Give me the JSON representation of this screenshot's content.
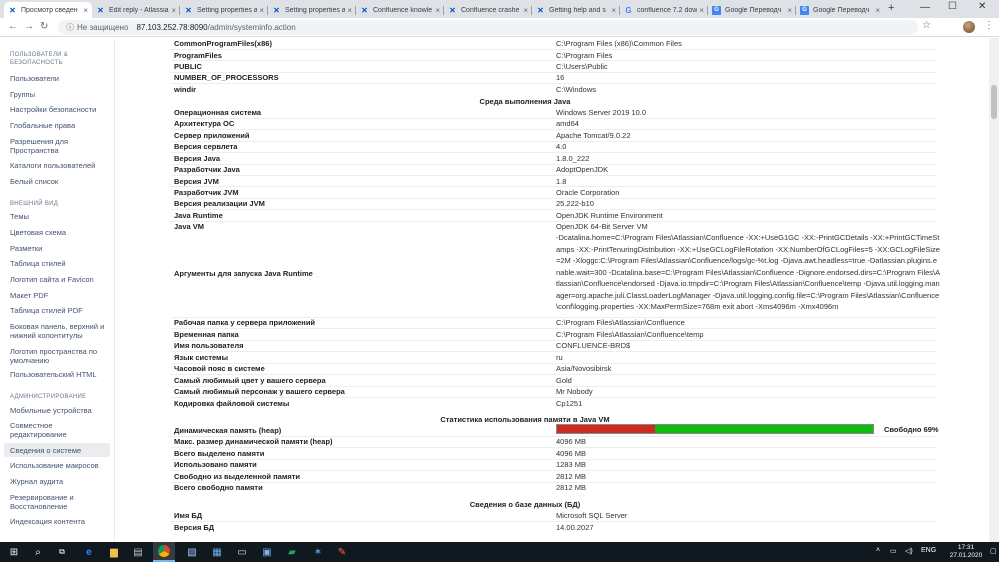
{
  "browser": {
    "tabs": [
      {
        "title": "Просмотр сведен",
        "icon": "confluence-icon",
        "active": true
      },
      {
        "title": "Edit reply - Atlassia",
        "icon": "confluence-icon"
      },
      {
        "title": "Setting properties a",
        "icon": "confluence-icon"
      },
      {
        "title": "Setting properties a",
        "icon": "confluence-icon"
      },
      {
        "title": "Confluence knowle",
        "icon": "confluence-icon"
      },
      {
        "title": "Confluence crashe",
        "icon": "confluence-icon"
      },
      {
        "title": "Getting help and s",
        "icon": "confluence-icon"
      },
      {
        "title": "confluence 7.2 dow",
        "icon": "google-icon"
      },
      {
        "title": "Google Переводч",
        "icon": "translate-icon"
      },
      {
        "title": "Google Переводч",
        "icon": "translate-icon"
      }
    ],
    "security_label": "Не защищено",
    "url_host": "87.103.252.78:8090",
    "url_path": "/admin/systeminfo.action"
  },
  "sidebar": {
    "sections": [
      {
        "heading": "ПОЛЬЗОВАТЕЛИ & БЕЗОПАСНОСТЬ",
        "items": [
          "Пользователи",
          "Группы",
          "Настройки безопасности",
          "Глобальные права",
          "Разрешения для Пространства",
          "Каталоги пользователей",
          "Белый список"
        ]
      },
      {
        "heading": "ВНЕШНИЙ ВИД",
        "items": [
          "Темы",
          "Цветовая схема",
          "Разметки",
          "Таблица стилей",
          "Логотип сайта и Favicon",
          "Макет PDF",
          "Таблица стилей PDF",
          "Боковая панель, верхний и нижний колонтитулы",
          "Логотип пространства по умолчанию",
          "Пользовательский HTML"
        ]
      },
      {
        "heading": "АДМИНИСТРИРОВАНИЕ",
        "items": [
          "Мобильные устройства",
          "Совместное редактирование",
          "Сведения о системе",
          "Использование макросов",
          "Журнал аудита",
          "Резервирование и Восстановление",
          "Индексация контента"
        ]
      }
    ],
    "active_item": "Сведения о системе"
  },
  "env_rows_top": [
    {
      "key": "CommonProgramFiles(x86)",
      "value": "C:\\Program Files (x86)\\Common Files"
    },
    {
      "key": "ProgramFiles",
      "value": "C:\\Program Files"
    },
    {
      "key": "PUBLIC",
      "value": "C:\\Users\\Public"
    },
    {
      "key": "NUMBER_OF_PROCESSORS",
      "value": "16"
    },
    {
      "key": "windir",
      "value": "C:\\Windows"
    }
  ],
  "java_section": {
    "title": "Среда выполнения Java",
    "rows": [
      {
        "key": "Операционная система",
        "value": "Windows Server 2019 10.0"
      },
      {
        "key": "Архитектура ОС",
        "value": "amd64"
      },
      {
        "key": "Сервер приложений",
        "value": "Apache Tomcat/9.0.22"
      },
      {
        "key": "Версия сервлета",
        "value": "4.0"
      },
      {
        "key": "Версия Java",
        "value": "1.8.0_222"
      },
      {
        "key": "Разработчик Java",
        "value": "AdoptOpenJDK"
      },
      {
        "key": "Версия JVM",
        "value": "1.8"
      },
      {
        "key": "Разработчик JVM",
        "value": "Oracle Corporation"
      },
      {
        "key": "Версия реализации JVM",
        "value": "25.222-b10"
      },
      {
        "key": "Java Runtime",
        "value": "OpenJDK Runtime Environment"
      },
      {
        "key": "Java VM",
        "value": "OpenJDK 64-Bit Server VM"
      }
    ],
    "runtime_args_key": "Аргументы для запуска Java Runtime",
    "runtime_args": "-Dcatalina.home=C:\\Program Files\\Atlassian\\Confluence -XX:+UseG1GC -XX:-PrintGCDetails -XX:+PrintGCTimeStamps -XX:-PrintTenuringDistribution -XX:+UseGCLogFileRotation -XX:NumberOfGCLogFiles=5 -XX:GCLogFileSize=2M -Xloggc:C:\\Program Files\\Atlassian\\Confluence/logs/gc-%t.log -Djava.awt.headless=true -Datlassian.plugins.enable.wait=300 -Dcatalina.base=C:\\Program Files\\Atlassian\\Confluence -Dignore.endorsed.dirs=C:\\Program Files\\Atlassian\\Confluence\\endorsed -Djava.io.tmpdir=C:\\Program Files\\Atlassian\\Confluence\\temp -Djava.util.logging.manager=org.apache.juli.ClassLoaderLogManager -Djava.util.logging.config.file=C:\\Program Files\\Atlassian\\Confluence\\conf\\logging.properties -XX:MaxPermSize=768m exit abort -Xms4096m -Xmx4096m",
    "rows_after": [
      {
        "key": "Рабочая папка у сервера приложений",
        "value": "C:\\Program Files\\Atlassian\\Confluence"
      },
      {
        "key": "Временная папка",
        "value": "C:\\Program Files\\Atlassian\\Confluence\\temp"
      },
      {
        "key": "Имя пользователя",
        "value": "CONFLUENCE-BRD$"
      },
      {
        "key": "Язык системы",
        "value": "ru"
      },
      {
        "key": "Часовой пояс в системе",
        "value": "Asia/Novosibirsk"
      },
      {
        "key": "Самый любимый цвет у вашего сервера",
        "value": "Gold"
      },
      {
        "key": "Самый любимый персонаж у вашего сервера",
        "value": "Mr Nobody"
      },
      {
        "key": "Кодировка файловой системы",
        "value": "Cp1251"
      }
    ]
  },
  "memory_section": {
    "title": "Статистика использования памяти в Java VM",
    "heap_key": "Динамическая память (heap)",
    "heap_used_fraction": 0.31,
    "heap_used_color": "#cc2b21",
    "heap_free_color": "#0fbd0f",
    "heap_free_label": "Свободно 69%",
    "rows": [
      {
        "key": "Макс. размер динамической памяти (heap)",
        "value": "4096 MB"
      },
      {
        "key": "Всего выделено памяти",
        "value": "4096 MB"
      },
      {
        "key": "Использовано памяти",
        "value": "1283 MB"
      },
      {
        "key": "Свободно из выделенной памяти",
        "value": "2812 MB"
      },
      {
        "key": "Всего свободно памяти",
        "value": "2812 MB"
      }
    ]
  },
  "db_section": {
    "title": "Сведения о базе данных (БД)",
    "rows": [
      {
        "key": "Имя БД",
        "value": "Microsoft SQL Server"
      },
      {
        "key": "Версия БД",
        "value": "14.00.2027"
      }
    ]
  },
  "taskbar": {
    "tray_lang": "ENG",
    "time": "17:31",
    "date": "27.01.2020"
  }
}
